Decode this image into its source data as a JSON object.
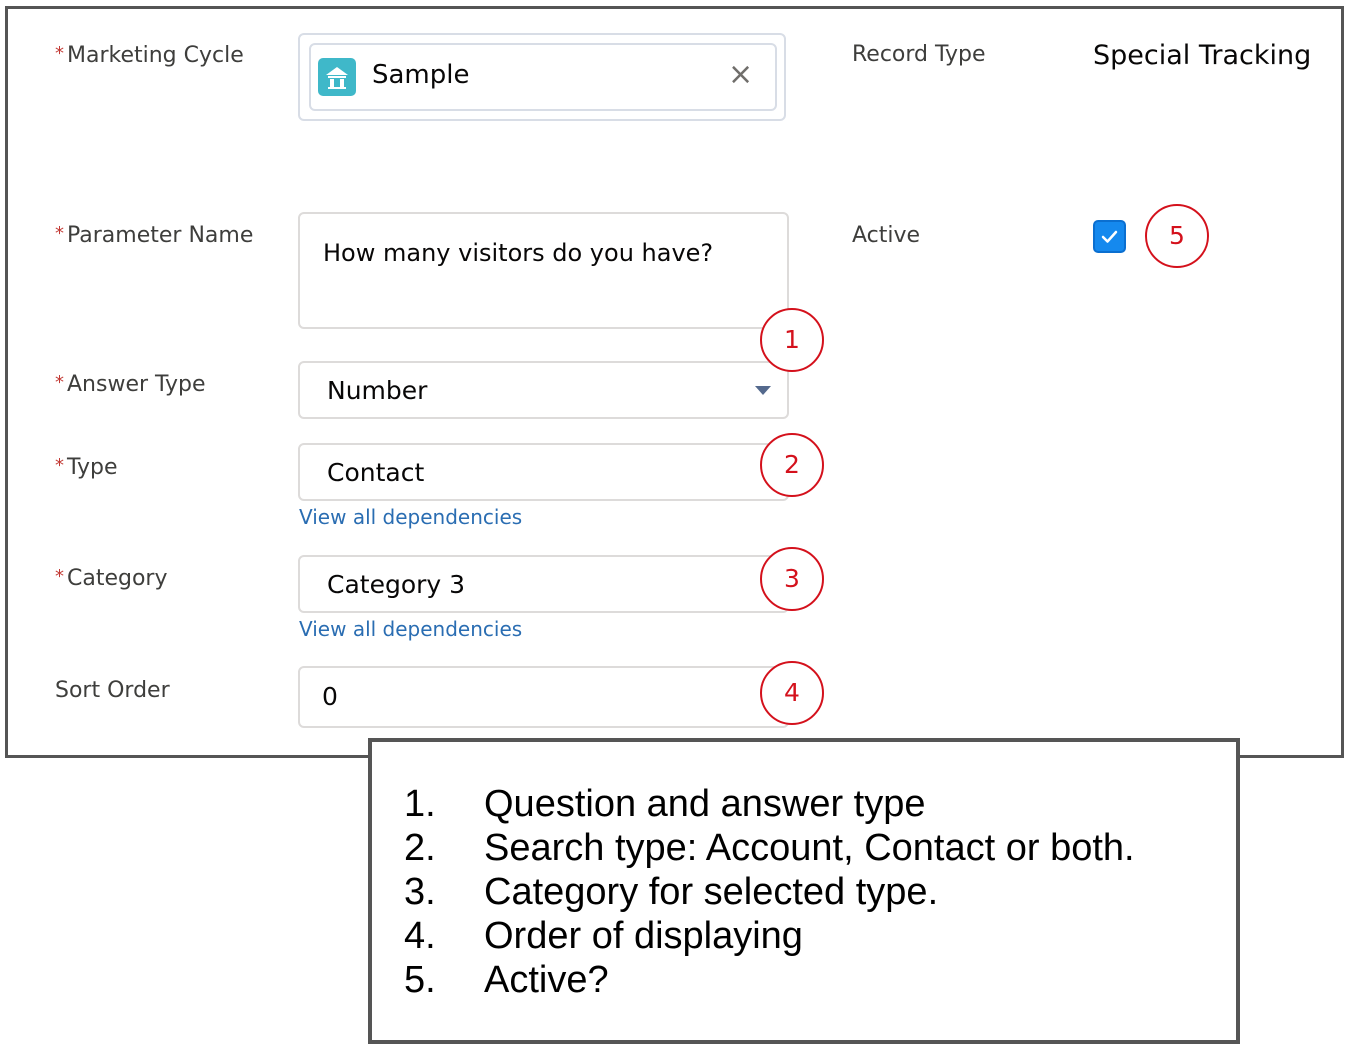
{
  "form": {
    "marketing_cycle": {
      "label": "Marketing Cycle",
      "value": "Sample",
      "object_icon": "marketing-cycle-icon",
      "clear_icon": "close-icon"
    },
    "record_type": {
      "label": "Record Type",
      "value": "Special Tracking"
    },
    "parameter_name": {
      "label": "Parameter Name",
      "value": "How many visitors do you have?"
    },
    "active": {
      "label": "Active",
      "checked": true
    },
    "answer_type": {
      "label": "Answer Type",
      "value": "Number"
    },
    "type": {
      "label": "Type",
      "value": "Contact",
      "link": "View all dependencies"
    },
    "category": {
      "label": "Category",
      "value": "Category 3",
      "link": "View all dependencies"
    },
    "sort_order": {
      "label": "Sort Order",
      "value": "0"
    },
    "required_marker": "*"
  },
  "callouts": [
    "1",
    "2",
    "3",
    "4",
    "5"
  ],
  "notes": {
    "items": [
      {
        "num": "1.",
        "text": "Question and answer type"
      },
      {
        "num": "2.",
        "text": "Search type: Account, Contact or both."
      },
      {
        "num": "3.",
        "text": "Category for selected type."
      },
      {
        "num": "4.",
        "text": "Order of displaying"
      },
      {
        "num": "5.",
        "text": "Active?"
      }
    ]
  },
  "colors": {
    "required": "#c23934",
    "link": "#2a6db2",
    "callout": "#d4111c",
    "checkbox": "#1589ee",
    "icon_teal": "#3fb8c9"
  }
}
